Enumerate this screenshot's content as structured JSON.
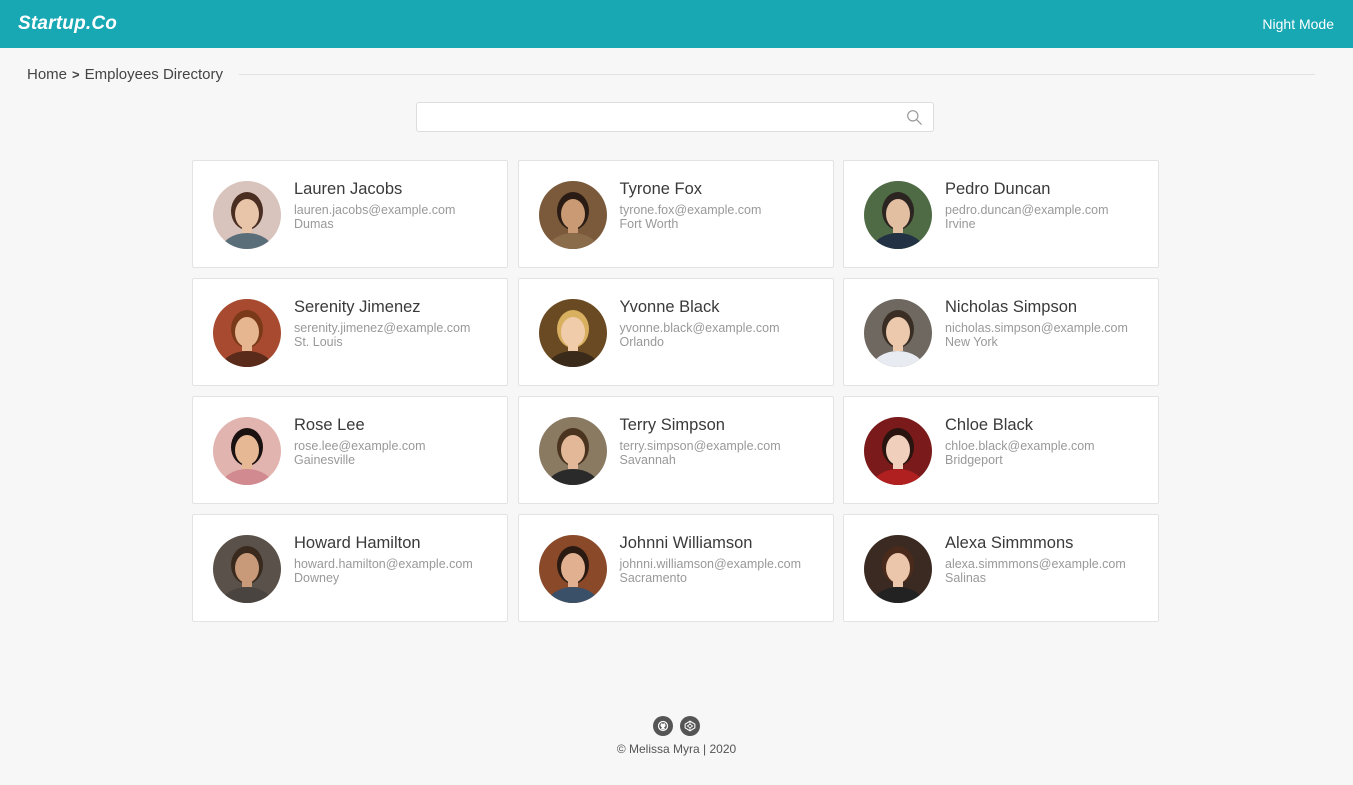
{
  "navbar": {
    "brand": "Startup.Co",
    "night_mode_label": "Night Mode"
  },
  "breadcrumb": {
    "home": "Home",
    "separator": ">",
    "current": "Employees Directory"
  },
  "search": {
    "value": "",
    "placeholder": "",
    "icon": "search-icon"
  },
  "employees": [
    {
      "name": "Lauren Jacobs",
      "email": "lauren.jacobs@example.com",
      "city": "Dumas",
      "avatar_bg": "#d9c4bd",
      "skin": "#e8c4a8",
      "hair": "#4a2e22",
      "shirt": "#5a6e7a"
    },
    {
      "name": "Tyrone Fox",
      "email": "tyrone.fox@example.com",
      "city": "Fort Worth",
      "avatar_bg": "#7a5a3a",
      "skin": "#c99a73",
      "hair": "#2a1c14",
      "shirt": "#8a6b4a"
    },
    {
      "name": "Pedro Duncan",
      "email": "pedro.duncan@example.com",
      "city": "Irvine",
      "avatar_bg": "#4e6b45",
      "skin": "#e3bfa2",
      "hair": "#2b2420",
      "shirt": "#223244"
    },
    {
      "name": "Serenity Jimenez",
      "email": "serenity.jimenez@example.com",
      "city": "St. Louis",
      "avatar_bg": "#a84a30",
      "skin": "#e6b690",
      "hair": "#7a3a1a",
      "shirt": "#5a2a1a"
    },
    {
      "name": "Yvonne Black",
      "email": "yvonne.black@example.com",
      "city": "Orlando",
      "avatar_bg": "#6a4a22",
      "skin": "#f0ccaa",
      "hair": "#d8b060",
      "shirt": "#3a2a1a"
    },
    {
      "name": "Nicholas Simpson",
      "email": "nicholas.simpson@example.com",
      "city": "New York",
      "avatar_bg": "#6e6860",
      "skin": "#ecc8ac",
      "hair": "#3a2e24",
      "shirt": "#e8ecf2"
    },
    {
      "name": "Rose Lee",
      "email": "rose.lee@example.com",
      "city": "Gainesville",
      "avatar_bg": "#e2b4b0",
      "skin": "#e6b894",
      "hair": "#1a1210",
      "shirt": "#d08a90"
    },
    {
      "name": "Terry Simpson",
      "email": "terry.simpson@example.com",
      "city": "Savannah",
      "avatar_bg": "#8a7a62",
      "skin": "#e2b898",
      "hair": "#4a3420",
      "shirt": "#2a2a2a"
    },
    {
      "name": "Chloe Black",
      "email": "chloe.black@example.com",
      "city": "Bridgeport",
      "avatar_bg": "#7a1a1a",
      "skin": "#f0d0bc",
      "hair": "#2a1410",
      "shirt": "#b02020"
    },
    {
      "name": "Howard Hamilton",
      "email": "howard.hamilton@example.com",
      "city": "Downey",
      "avatar_bg": "#5a524a",
      "skin": "#c89a7a",
      "hair": "#3a2a1e",
      "shirt": "#4a4440"
    },
    {
      "name": "Johnni Williamson",
      "email": "johnni.williamson@example.com",
      "city": "Sacramento",
      "avatar_bg": "#8a4a2a",
      "skin": "#e0b090",
      "hair": "#2a1a12",
      "shirt": "#3a5068"
    },
    {
      "name": "Alexa Simmmons",
      "email": "alexa.simmmons@example.com",
      "city": "Salinas",
      "avatar_bg": "#3a2a22",
      "skin": "#ecc6aa",
      "hair": "#4a2a1a",
      "shirt": "#222222"
    }
  ],
  "footer": {
    "icons": [
      "github-icon",
      "codepen-icon"
    ],
    "copyright": "© Melissa Myra | 2020"
  },
  "colors": {
    "navbar": "#17a8b4",
    "background": "#f7f7f7",
    "card": "#ffffff"
  }
}
